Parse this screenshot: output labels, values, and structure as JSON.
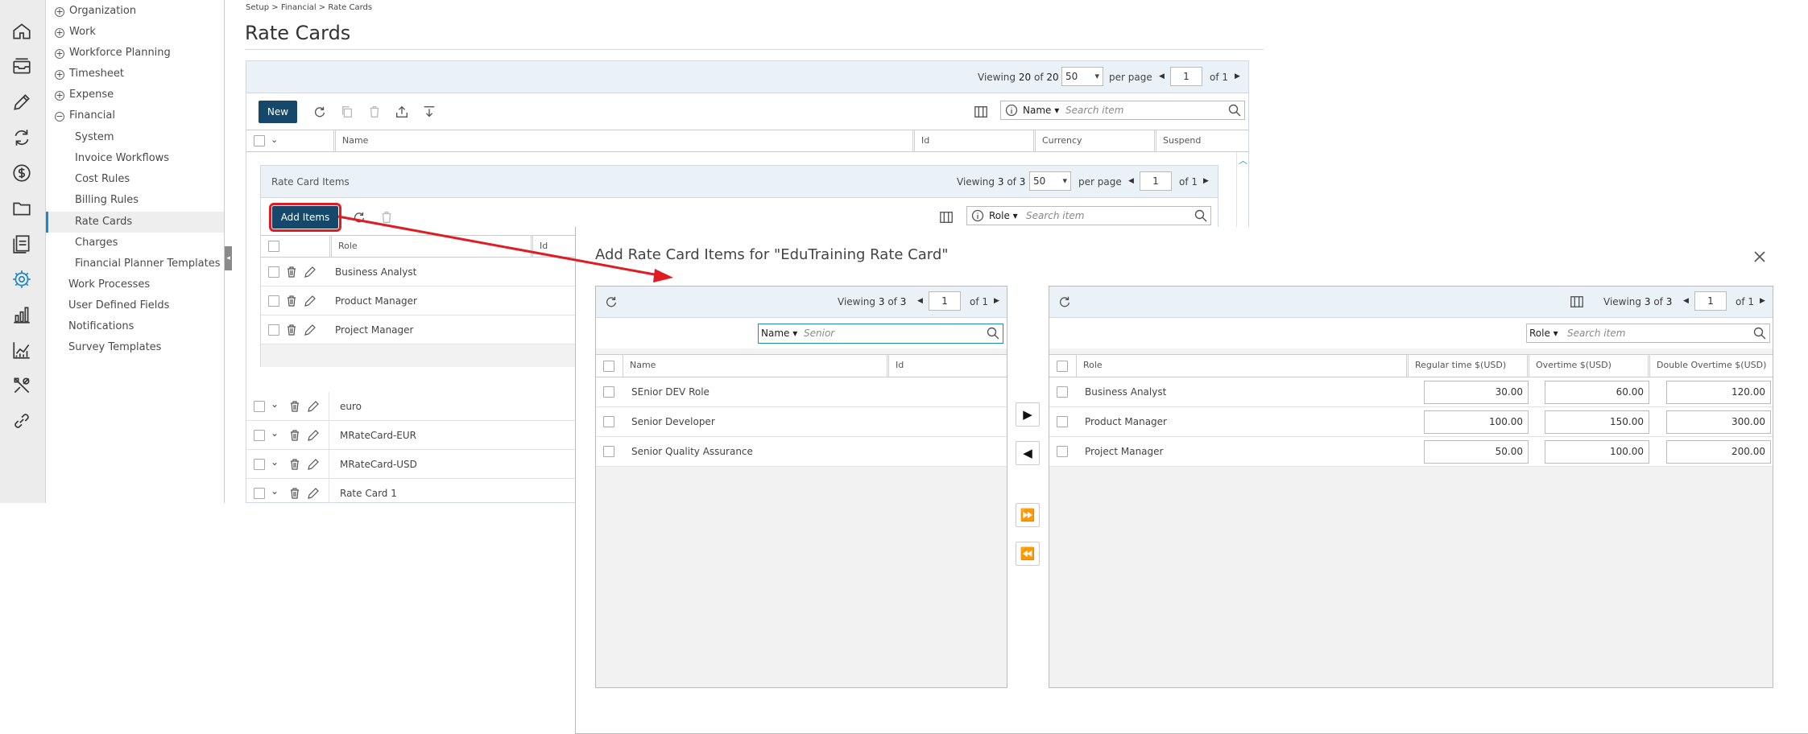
{
  "breadcrumb": "Setup > Financial > Rate Cards",
  "page_title": "Rate Cards",
  "colors": {
    "primary": "#15486a",
    "accent": "#1e88c8",
    "annotation": "#e11b22"
  },
  "rail_icons": [
    "home-icon",
    "tray-icon",
    "pencil-icon",
    "sync-icon",
    "dollar-icon",
    "folder-icon",
    "checklist-icon",
    "gear-icon",
    "bar-chart-icon",
    "line-chart-icon",
    "tools-icon",
    "link-icon"
  ],
  "nav": {
    "groups": [
      {
        "label": "Organization",
        "state": "+"
      },
      {
        "label": "Work",
        "state": "+"
      },
      {
        "label": "Workforce Planning",
        "state": "+"
      },
      {
        "label": "Timesheet",
        "state": "+"
      },
      {
        "label": "Expense",
        "state": "+"
      },
      {
        "label": "Financial",
        "state": "−"
      }
    ],
    "financial_children": [
      "System",
      "Invoice Workflows",
      "Cost Rules",
      "Billing Rules",
      "Rate Cards",
      "Charges",
      "Financial Planner Templates"
    ],
    "after": [
      "Work Processes",
      "User Defined Fields",
      "Notifications",
      "Survey Templates"
    ]
  },
  "main_grid": {
    "viewing_prefix": "Viewing",
    "viewing_count": "20",
    "of": "of",
    "viewing_total": "20",
    "per_page": "50",
    "per_page_label": "per page",
    "page": "1",
    "of_pages": "of 1",
    "new_label": "New",
    "search_field": "Name",
    "search_placeholder": "Search item",
    "columns": [
      "Name",
      "Id",
      "Currency",
      "Suspend"
    ],
    "rows": [
      "euro",
      "MRateCard-EUR",
      "MRateCard-USD",
      "Rate Card 1"
    ]
  },
  "rci": {
    "title": "Rate Card Items",
    "viewing_prefix": "Viewing",
    "viewing_count": "3",
    "of": "of",
    "viewing_total": "3",
    "per_page": "50",
    "per_page_label": "per page",
    "page": "1",
    "of_pages": "of 1",
    "add_label": "Add Items",
    "search_field": "Role",
    "search_placeholder": "Search item",
    "columns": [
      "Role",
      "Id"
    ],
    "rows": [
      "Business Analyst",
      "Product Manager",
      "Project Manager"
    ]
  },
  "modal": {
    "title": "Add Rate Card Items for \"EduTraining Rate Card\"",
    "left": {
      "viewing_prefix": "Viewing",
      "viewing_count": "3",
      "of": "of",
      "viewing_total": "3",
      "page": "1",
      "of_pages": "of 1",
      "search_field": "Name",
      "search_value": "Senior",
      "columns": [
        "Name",
        "Id"
      ],
      "rows": [
        "SEnior DEV Role",
        "Senior Developer",
        "Senior Quality Assurance"
      ]
    },
    "right": {
      "viewing_prefix": "Viewing",
      "viewing_count": "3",
      "of": "of",
      "viewing_total": "3",
      "page": "1",
      "of_pages": "of 1",
      "search_field": "Role",
      "search_placeholder": "Search item",
      "columns": [
        "Role",
        "Regular time $(USD)",
        "Overtime $(USD)",
        "Double Overtime $(USD)"
      ],
      "rows": [
        {
          "role": "Business Analyst",
          "regular": "30.00",
          "overtime": "60.00",
          "double": "120.00"
        },
        {
          "role": "Product Manager",
          "regular": "100.00",
          "overtime": "150.00",
          "double": "300.00"
        },
        {
          "role": "Project Manager",
          "regular": "50.00",
          "overtime": "100.00",
          "double": "200.00"
        }
      ]
    },
    "move_buttons": [
      "▶",
      "◀",
      "⏩",
      "⏪"
    ]
  }
}
